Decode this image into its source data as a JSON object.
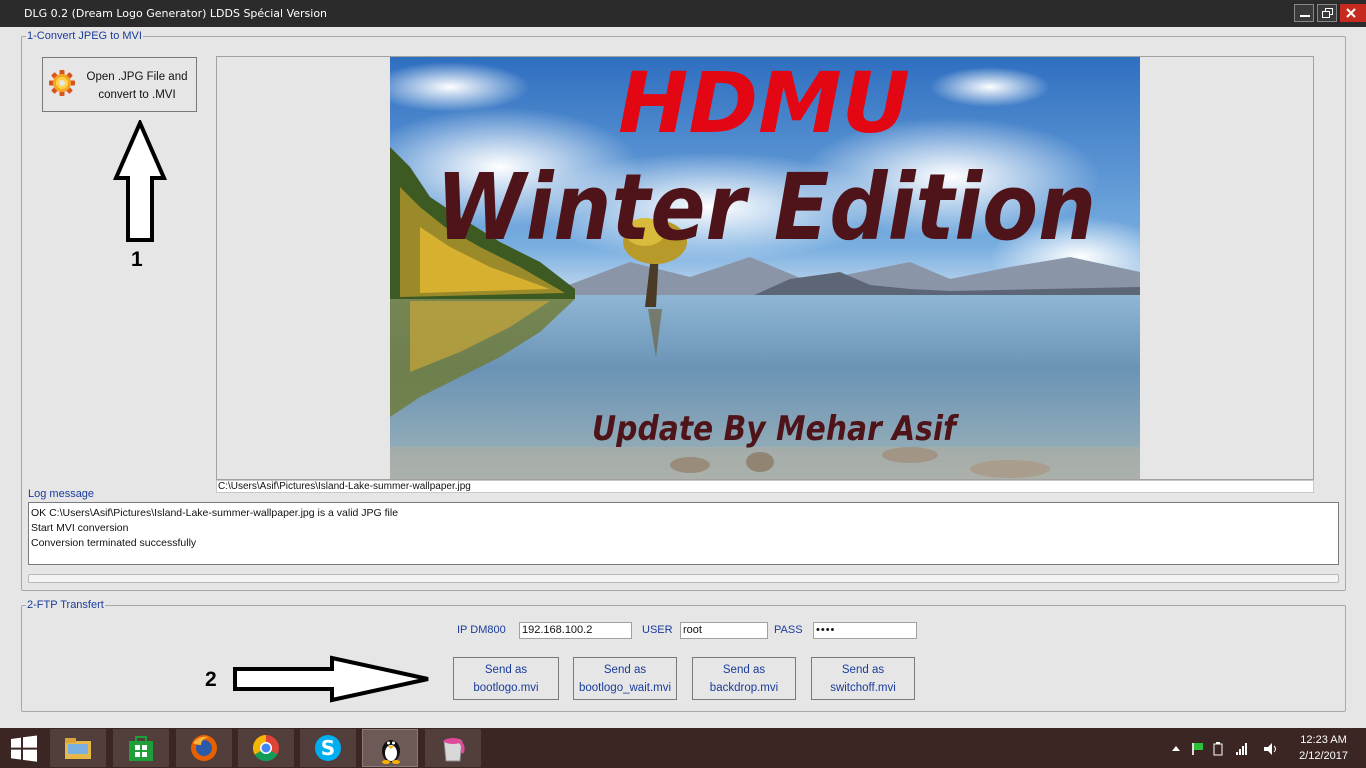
{
  "window": {
    "title": "DLG 0.2 (Dream Logo Generator) LDDS Spécial Version"
  },
  "convert_group": {
    "legend": "1-Convert JPEG to MVI",
    "open_button": {
      "line1": "Open .JPG File and",
      "line2": "convert to .MVI",
      "icon": "gear-icon"
    },
    "image": {
      "headline": "HDMU",
      "subheadline": "Winter Edition",
      "credit": "Update By Mehar Asif"
    },
    "file_path": "C:\\Users\\Asif\\Pictures\\Island-Lake-summer-wallpaper.jpg",
    "log_label": "Log message",
    "log_lines": [
      "OK C:\\Users\\Asif\\Pictures\\Island-Lake-summer-wallpaper.jpg is a valid JPG file",
      "Start MVI conversion",
      "Conversion terminated successfully"
    ]
  },
  "ftp_group": {
    "legend": "2-FTP Transfert",
    "ip_label": "IP DM800",
    "ip_value": "192.168.100.2",
    "user_label": "USER",
    "user_value": "root",
    "pass_label": "PASS",
    "pass_value": "••••",
    "buttons": [
      {
        "line1": "Send as",
        "line2": "bootlogo.mvi"
      },
      {
        "line1": "Send as",
        "line2": "bootlogo_wait.mvi"
      },
      {
        "line1": "Send as",
        "line2": "backdrop.mvi"
      },
      {
        "line1": "Send as",
        "line2": "switchoff.mvi"
      }
    ]
  },
  "annotations": {
    "step1": "1",
    "step2": "2"
  },
  "taskbar": {
    "apps": [
      "start-icon",
      "file-explorer-icon",
      "store-icon",
      "firefox-icon",
      "chrome-icon",
      "skype-icon",
      "linux-tux-icon",
      "paint-bucket-icon"
    ],
    "clock_time": "12:23 AM",
    "clock_date": "2/12/2017"
  },
  "colors": {
    "accent_text": "#1a3c9c",
    "headline": "#e30613",
    "subheadline": "#4e1419",
    "taskbar": "#3b2624"
  }
}
